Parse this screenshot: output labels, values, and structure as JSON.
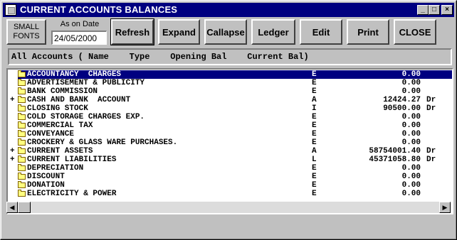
{
  "window": {
    "title": "CURRENT ACCOUNTS BALANCES"
  },
  "titlebar_buttons": {
    "minimize": "_",
    "maximize": "□",
    "close": "×"
  },
  "toolbar": {
    "small_fonts_line1": "SMALL",
    "small_fonts_line2": "FONTS",
    "as_on_date_label": "As on Date",
    "date_value": "24/05/2000",
    "refresh": "Refresh",
    "expand": "Expand",
    "collapse": "Callapse",
    "ledger": "Ledger",
    "edit": "Edit",
    "print": "Print",
    "close": "CLOSE"
  },
  "header": {
    "text": "All Accounts ( Name    Type    Opening Bal    Current Bal)"
  },
  "accounts": [
    {
      "expander": "",
      "name": "ACCOUNTANCY  CHARGES",
      "type": "E",
      "balance": "0.00",
      "drcr": "",
      "selected": true
    },
    {
      "expander": "",
      "name": "ADVERTISEMENT & PUBLICITY",
      "type": "E",
      "balance": "0.00",
      "drcr": ""
    },
    {
      "expander": "",
      "name": "BANK COMMISSION",
      "type": "E",
      "balance": "0.00",
      "drcr": ""
    },
    {
      "expander": "+",
      "name": "CASH AND BANK  ACCOUNT",
      "type": "A",
      "balance": "12424.27",
      "drcr": "Dr"
    },
    {
      "expander": "",
      "name": "CLOSING STOCK",
      "type": "I",
      "balance": "90500.00",
      "drcr": "Dr"
    },
    {
      "expander": "",
      "name": "COLD STORAGE CHARGES EXP.",
      "type": "E",
      "balance": "0.00",
      "drcr": ""
    },
    {
      "expander": "",
      "name": "COMMERCIAL TAX",
      "type": "E",
      "balance": "0.00",
      "drcr": ""
    },
    {
      "expander": "",
      "name": "CONVEYANCE",
      "type": "E",
      "balance": "0.00",
      "drcr": ""
    },
    {
      "expander": "",
      "name": "CROCKERY & GLASS WARE PURCHASES.",
      "type": "E",
      "balance": "0.00",
      "drcr": ""
    },
    {
      "expander": "+",
      "name": "CURRENT ASSETS",
      "type": "A",
      "balance": "58754001.40",
      "drcr": "Dr"
    },
    {
      "expander": "+",
      "name": "CURRENT LIABILITIES",
      "type": "L",
      "balance": "45371058.80",
      "drcr": "Dr"
    },
    {
      "expander": "",
      "name": "DEPRECIATION",
      "type": "E",
      "balance": "0.00",
      "drcr": ""
    },
    {
      "expander": "",
      "name": "DISCOUNT",
      "type": "E",
      "balance": "0.00",
      "drcr": ""
    },
    {
      "expander": "",
      "name": "DONATION",
      "type": "E",
      "balance": "0.00",
      "drcr": ""
    },
    {
      "expander": "",
      "name": "ELECTRICITY & POWER",
      "type": "E",
      "balance": "0.00",
      "drcr": ""
    }
  ],
  "scrollbar": {
    "left_arrow": "◀",
    "right_arrow": "▶"
  }
}
